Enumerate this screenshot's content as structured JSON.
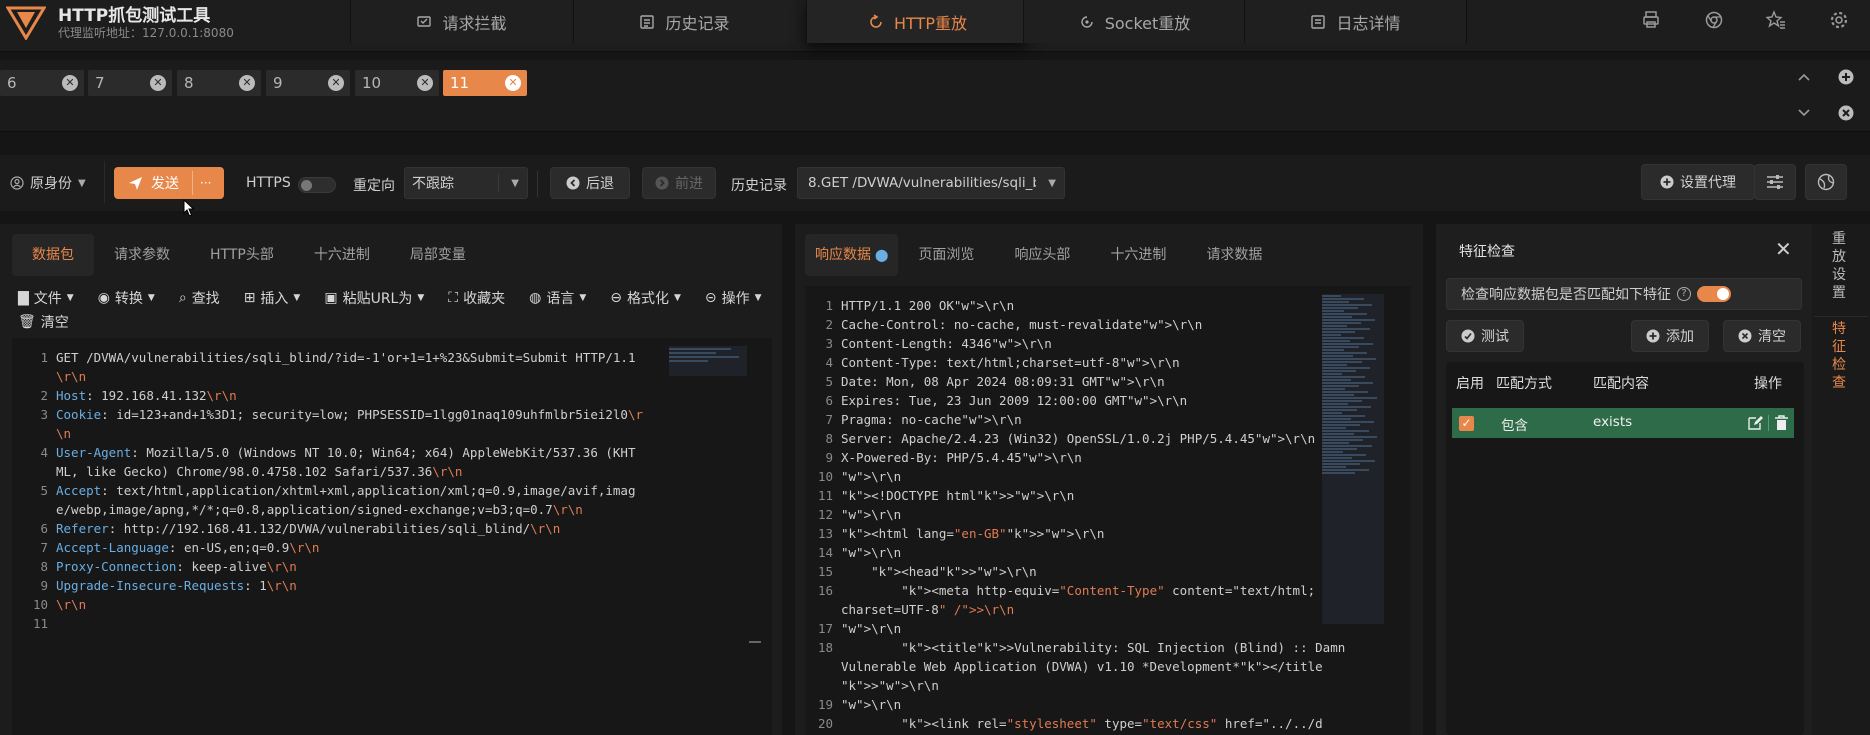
{
  "app": {
    "title": "HTTP抓包测试工具",
    "subtitle": "代理监听地址：127.0.0.1:8080"
  },
  "nav": [
    {
      "label": "请求拦截",
      "icon": "intercept-icon"
    },
    {
      "label": "历史记录",
      "icon": "history-icon"
    },
    {
      "label": "HTTP重放",
      "icon": "replay-icon"
    },
    {
      "label": "Socket重放",
      "icon": "socket-icon"
    },
    {
      "label": "日志详情",
      "icon": "log-icon"
    }
  ],
  "request_tabs": [
    "6",
    "7",
    "8",
    "9",
    "10",
    "11"
  ],
  "toolbar": {
    "identity": "原身份",
    "send": "发送",
    "more": "···",
    "https": "HTTPS",
    "redirect": "重定向",
    "redirect_value": "不跟踪",
    "back": "后退",
    "forward": "前进",
    "history_label": "历史记录",
    "history_value": "8.GET /DVWA/vulnerabilities/sqli_b...",
    "proxy": "设置代理"
  },
  "request_panel": {
    "tabs": [
      "数据包",
      "请求参数",
      "HTTP头部",
      "十六进制",
      "局部变量"
    ],
    "tools": [
      "文件",
      "转换",
      "查找",
      "插入",
      "粘贴URL为",
      "收藏夹",
      "语言",
      "格式化",
      "操作",
      "清空"
    ],
    "lines": [
      {
        "n": "1",
        "t": "GET /DVWA/vulnerabilities/sqli_blind/?id=-1'or+1=1+%23&Submit=Submit HTTP/1.1"
      },
      {
        "n": "",
        "t": "\\r\\n"
      },
      {
        "n": "2",
        "t": "Host: 192.168.41.132\\r\\n"
      },
      {
        "n": "3",
        "t": "Cookie: id=123+and+1%3D1; security=low; PHPSESSID=1lgg01naq109uhfmlbr5iei2l0\\r"
      },
      {
        "n": "",
        "t": "\\n"
      },
      {
        "n": "4",
        "t": "User-Agent: Mozilla/5.0 (Windows NT 10.0; Win64; x64) AppleWebKit/537.36 (KHT"
      },
      {
        "n": "",
        "t": "ML, like Gecko) Chrome/98.0.4758.102 Safari/537.36\\r\\n"
      },
      {
        "n": "5",
        "t": "Accept: text/html,application/xhtml+xml,application/xml;q=0.9,image/avif,imag"
      },
      {
        "n": "",
        "t": "e/webp,image/apng,*/*;q=0.8,application/signed-exchange;v=b3;q=0.7\\r\\n"
      },
      {
        "n": "6",
        "t": "Referer: http://192.168.41.132/DVWA/vulnerabilities/sqli_blind/\\r\\n"
      },
      {
        "n": "7",
        "t": "Accept-Language: en-US,en;q=0.9\\r\\n"
      },
      {
        "n": "8",
        "t": "Proxy-Connection: keep-alive\\r\\n"
      },
      {
        "n": "9",
        "t": "Upgrade-Insecure-Requests: 1\\r\\n"
      },
      {
        "n": "10",
        "t": "\\r\\n"
      },
      {
        "n": "11",
        "t": ""
      }
    ]
  },
  "response_panel": {
    "tabs": [
      "响应数据",
      "页面浏览",
      "响应头部",
      "十六进制",
      "请求数据"
    ],
    "lines": [
      {
        "n": "1",
        "t": "HTTP/1.1 200 OK\\r\\n"
      },
      {
        "n": "2",
        "t": "Cache-Control: no-cache, must-revalidate\\r\\n"
      },
      {
        "n": "3",
        "t": "Content-Length: 4346\\r\\n"
      },
      {
        "n": "4",
        "t": "Content-Type: text/html;charset=utf-8\\r\\n"
      },
      {
        "n": "5",
        "t": "Date: Mon, 08 Apr 2024 08:09:31 GMT\\r\\n"
      },
      {
        "n": "6",
        "t": "Expires: Tue, 23 Jun 2009 12:00:00 GMT\\r\\n"
      },
      {
        "n": "7",
        "t": "Pragma: no-cache\\r\\n"
      },
      {
        "n": "8",
        "t": "Server: Apache/2.4.23 (Win32) OpenSSL/1.0.2j PHP/5.4.45\\r\\n"
      },
      {
        "n": "9",
        "t": "X-Powered-By: PHP/5.4.45\\r\\n"
      },
      {
        "n": "10",
        "t": "\\r\\n"
      },
      {
        "n": "11",
        "t": "<!DOCTYPE html>\\r\\n"
      },
      {
        "n": "12",
        "t": "\\r\\n"
      },
      {
        "n": "13",
        "t": "<html lang=\"en-GB\">\\r\\n"
      },
      {
        "n": "14",
        "t": "\\r\\n"
      },
      {
        "n": "15",
        "t": "    <head>\\r\\n"
      },
      {
        "n": "16",
        "t": "        <meta http-equiv=\"Content-Type\" content=\"text/html;"
      },
      {
        "n": "",
        "t": "charset=UTF-8\" />\\r\\n"
      },
      {
        "n": "17",
        "t": "\\r\\n"
      },
      {
        "n": "18",
        "t": "        <title>Vulnerability: SQL Injection (Blind) :: Damn"
      },
      {
        "n": "",
        "t": "Vulnerable Web Application (DVWA) v1.10 *Development*</title"
      },
      {
        "n": "",
        "t": ">\\r\\n"
      },
      {
        "n": "19",
        "t": "\\r\\n"
      },
      {
        "n": "20",
        "t": "        <link rel=\"stylesheet\" type=\"text/css\" href=\"../../d"
      }
    ]
  },
  "feature_panel": {
    "title": "特征检查",
    "check_label": "检查响应数据包是否匹配如下特征",
    "test": "测试",
    "add": "添加",
    "clear": "清空",
    "headers": [
      "启用",
      "匹配方式",
      "匹配内容",
      "操作"
    ],
    "rows": [
      {
        "mode": "包含",
        "content": "exists"
      }
    ]
  },
  "side_tabs": [
    "重放设置",
    "特征检查"
  ],
  "colors": {
    "accent": "#e8874a",
    "row_green": "#2e6b49"
  }
}
